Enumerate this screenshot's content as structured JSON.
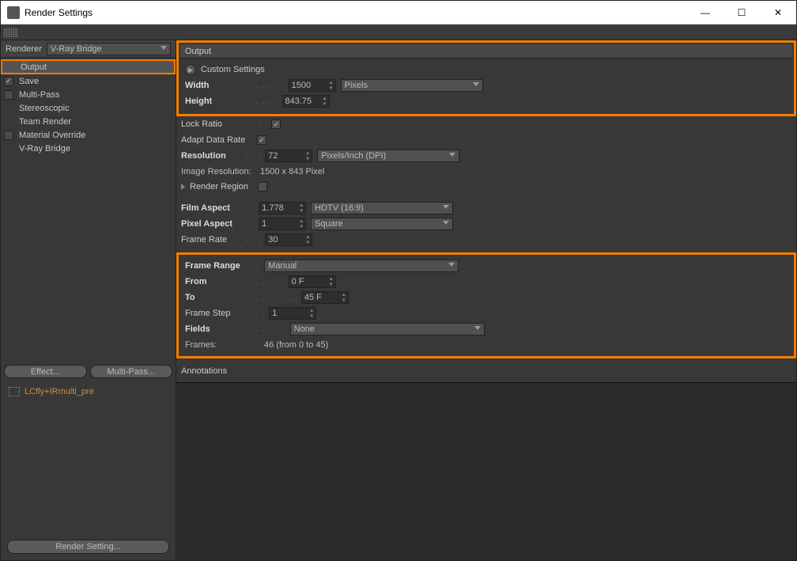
{
  "window": {
    "title": "Render Settings"
  },
  "titlebar": {
    "minimize": "—",
    "maximize": "☐",
    "close": "✕"
  },
  "renderer": {
    "label": "Renderer",
    "value": "V-Ray Bridge"
  },
  "tree": {
    "output": "Output",
    "save": "Save",
    "multipass": "Multi-Pass",
    "stereoscopic": "Stereoscopic",
    "teamrender": "Team Render",
    "materialoverride": "Material Override",
    "vraybridge": "V-Ray Bridge"
  },
  "sidebar_buttons": {
    "effect": "Effect...",
    "multipass": "Multi-Pass..."
  },
  "preset": {
    "name": "LCfly+IRmulti_pre"
  },
  "status_button": "Render Setting...",
  "output": {
    "header": "Output",
    "custom_settings": "Custom Settings",
    "width_label": "Width",
    "width_val": "1500",
    "height_label": "Height",
    "height_val": "843.75",
    "units": "Pixels",
    "lock_ratio": "Lock Ratio",
    "adapt_data_rate": "Adapt Data Rate",
    "resolution_label": "Resolution",
    "resolution_val": "72",
    "resolution_units": "Pixels/Inch (DPI)",
    "image_resolution_label": "Image Resolution:",
    "image_resolution_val": "1500 x 843 Pixel",
    "render_region": "Render Region",
    "film_aspect_label": "Film Aspect",
    "film_aspect_val": "1.778",
    "film_aspect_sel": "HDTV (16:9)",
    "pixel_aspect_label": "Pixel Aspect",
    "pixel_aspect_val": "1",
    "pixel_aspect_sel": "Square",
    "frame_rate_label": "Frame Rate",
    "frame_rate_val": "30",
    "frame_range_label": "Frame Range",
    "frame_range_sel": "Manual",
    "from_label": "From",
    "from_val": "0 F",
    "to_label": "To",
    "to_val": "45 F",
    "frame_step_label": "Frame Step",
    "frame_step_val": "1",
    "fields_label": "Fields",
    "fields_sel": "None",
    "frames_label": "Frames:",
    "frames_val": "46 (from 0 to 45)",
    "annotations": "Annotations"
  }
}
